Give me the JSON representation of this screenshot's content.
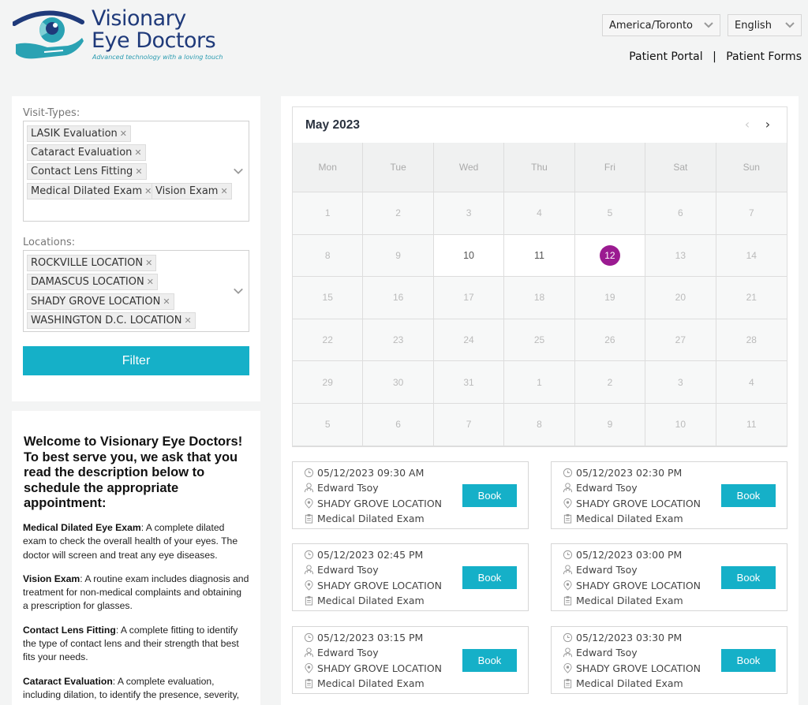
{
  "brand": {
    "name_line1": "Visionary",
    "name_line2": "Eye Doctors",
    "tagline": "Advanced technology with a loving touch",
    "colors": {
      "navy": "#1f3a7a",
      "teal": "#2a9bb0",
      "accent": "#15b0c8",
      "selected_day": "#9b1b91"
    }
  },
  "header": {
    "timezone_select": "America/Toronto",
    "language_select": "English",
    "links": [
      "Patient Portal",
      "Patient Forms"
    ],
    "separator": "|"
  },
  "filters": {
    "visit_types_label": "Visit-Types:",
    "visit_types": [
      "LASIK Evaluation",
      "Cataract Evaluation",
      "Contact Lens Fitting",
      "Medical Dilated Exam",
      "Vision Exam"
    ],
    "locations_label": "Locations:",
    "locations": [
      "ROCKVILLE LOCATION",
      "DAMASCUS LOCATION",
      "SHADY GROVE LOCATION",
      "WASHINGTON D.C. LOCATION"
    ],
    "remove_glyph": "✕",
    "filter_button": "Filter"
  },
  "info": {
    "heading": "Welcome to Visionary Eye Doctors! To best serve you, we ask that you read the description below to schedule the appropriate appointment:",
    "items": [
      {
        "term": "Medical Dilated Eye Exam",
        "desc": ": A complete dilated exam to check the overall health of your eyes. The doctor will screen and treat any eye diseases."
      },
      {
        "term": "Vision Exam",
        "desc": ": A routine exam includes diagnosis and treatment for non-medical complaints and obtaining a prescription for glasses."
      },
      {
        "term": "Contact Lens Fitting",
        "desc": ": A complete fitting to identify the type of contact lens and their strength that best fits your needs."
      },
      {
        "term": "Cataract Evaluation",
        "desc": ": A complete evaluation, including dilation, to identify the presence, severity,"
      }
    ]
  },
  "calendar": {
    "title": "May 2023",
    "prev": "‹",
    "next": "›",
    "weekdays": [
      "Mon",
      "Tue",
      "Wed",
      "Thu",
      "Fri",
      "Sat",
      "Sun"
    ],
    "days": [
      "1",
      "2",
      "3",
      "4",
      "5",
      "6",
      "7",
      "8",
      "9",
      "10",
      "11",
      "12",
      "13",
      "14",
      "15",
      "16",
      "17",
      "18",
      "19",
      "20",
      "21",
      "22",
      "23",
      "24",
      "25",
      "26",
      "27",
      "28",
      "29",
      "30",
      "31",
      "1",
      "2",
      "3",
      "4",
      "5",
      "6",
      "7",
      "8",
      "9",
      "10",
      "11"
    ],
    "available_indexes": [
      9,
      10,
      11
    ],
    "selected_index": 11
  },
  "slots": [
    {
      "datetime": "05/12/2023 09:30 AM",
      "doctor": "Edward Tsoy",
      "location": "SHADY GROVE LOCATION",
      "visit": "Medical Dilated Exam",
      "button": "Book"
    },
    {
      "datetime": "05/12/2023 02:30 PM",
      "doctor": "Edward Tsoy",
      "location": "SHADY GROVE LOCATION",
      "visit": "Medical Dilated Exam",
      "button": "Book"
    },
    {
      "datetime": "05/12/2023 02:45 PM",
      "doctor": "Edward Tsoy",
      "location": "SHADY GROVE LOCATION",
      "visit": "Medical Dilated Exam",
      "button": "Book"
    },
    {
      "datetime": "05/12/2023 03:00 PM",
      "doctor": "Edward Tsoy",
      "location": "SHADY GROVE LOCATION",
      "visit": "Medical Dilated Exam",
      "button": "Book"
    },
    {
      "datetime": "05/12/2023 03:15 PM",
      "doctor": "Edward Tsoy",
      "location": "SHADY GROVE LOCATION",
      "visit": "Medical Dilated Exam",
      "button": "Book"
    },
    {
      "datetime": "05/12/2023 03:30 PM",
      "doctor": "Edward Tsoy",
      "location": "SHADY GROVE LOCATION",
      "visit": "Medical Dilated Exam",
      "button": "Book"
    }
  ]
}
